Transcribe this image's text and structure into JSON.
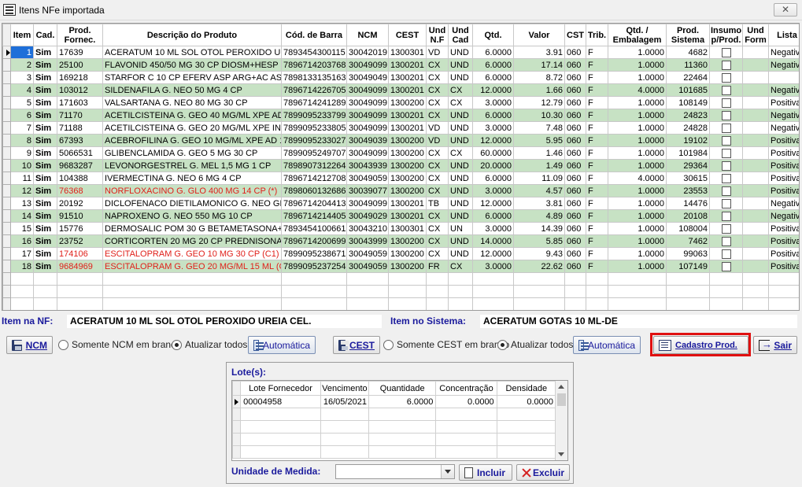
{
  "window": {
    "title": "Itens NFe importada",
    "close_label": "✕"
  },
  "grid": {
    "headers": {
      "item": "Item",
      "cad": "Cad.",
      "forn": "Prod.\nFornec.",
      "desc": "Descrição do Produto",
      "barra": "Cód. de Barra",
      "ncm": "NCM",
      "cest": "CEST",
      "undnf": "Und\nN.F",
      "undcad": "Und\nCad",
      "qtd": "Qtd.",
      "valor": "Valor",
      "cst": "CST",
      "trib": "Trib.",
      "qtdemb": "Qtd. /\nEmbalagem",
      "prodsis": "Prod.\nSistema",
      "insumo": "Insumo\np/Prod.",
      "undform": "Und\nForm",
      "lista": "Lista"
    },
    "rows": [
      {
        "item": "1",
        "cad": "Sim",
        "forn": "17639",
        "desc": "ACERATUM 10 ML SOL OTOL PEROXIDO UREIA CEL.",
        "barra": "7893454300115",
        "ncm": "30042019",
        "cest": "1300301",
        "undnf": "VD",
        "undcad": "UND",
        "qtd": "6.0000",
        "valor": "3.91",
        "cst": "060",
        "trib": "F",
        "qtdemb": "1.0000",
        "prodsis": "4682",
        "undform": "",
        "lista": "Negativa",
        "red": false
      },
      {
        "item": "2",
        "cad": "Sim",
        "forn": "25100",
        "desc": "FLAVONID 450/50 MG 30 CP DIOSM+HESP NEO",
        "barra": "7896714203768",
        "ncm": "30049099",
        "cest": "1300201",
        "undnf": "CX",
        "undcad": "UND",
        "qtd": "6.0000",
        "valor": "17.14",
        "cst": "060",
        "trib": "F",
        "qtdemb": "1.0000",
        "prodsis": "11360",
        "undform": "",
        "lista": "Negativa",
        "red": false
      },
      {
        "item": "3",
        "cad": "Sim",
        "forn": "169218",
        "desc": "STARFOR C 10 CP EFERV ASP ARG+AC ASC",
        "barra": "7898133135163",
        "ncm": "30049049",
        "cest": "1300201",
        "undnf": "CX",
        "undcad": "UND",
        "qtd": "6.0000",
        "valor": "8.72",
        "cst": "060",
        "trib": "F",
        "qtdemb": "1.0000",
        "prodsis": "22464",
        "undform": "",
        "lista": "",
        "red": false
      },
      {
        "item": "4",
        "cad": "Sim",
        "forn": "103012",
        "desc": "SILDENAFILA G. NEO 50 MG 4 CP",
        "barra": "7896714226705",
        "ncm": "30049099",
        "cest": "1300201",
        "undnf": "CX",
        "undcad": "CX",
        "qtd": "12.0000",
        "valor": "1.66",
        "cst": "060",
        "trib": "F",
        "qtdemb": "4.0000",
        "prodsis": "101685",
        "undform": "",
        "lista": "Negativa",
        "red": false
      },
      {
        "item": "5",
        "cad": "Sim",
        "forn": "171603",
        "desc": "VALSARTANA G. NEO 80 MG 30 CP",
        "barra": "7896714241289",
        "ncm": "30049099",
        "cest": "1300200",
        "undnf": "CX",
        "undcad": "CX",
        "qtd": "3.0000",
        "valor": "12.79",
        "cst": "060",
        "trib": "F",
        "qtdemb": "1.0000",
        "prodsis": "108149",
        "undform": "",
        "lista": "Positiva",
        "red": false
      },
      {
        "item": "6",
        "cad": "Sim",
        "forn": "71170",
        "desc": "ACETILCISTEINA G. GEO 40 MG/ML XPE AD 120 ML",
        "barra": "7899095233799",
        "ncm": "30049099",
        "cest": "1300201",
        "undnf": "CX",
        "undcad": "UND",
        "qtd": "6.0000",
        "valor": "10.30",
        "cst": "060",
        "trib": "F",
        "qtdemb": "1.0000",
        "prodsis": "24823",
        "undform": "",
        "lista": "Negativa",
        "red": false
      },
      {
        "item": "7",
        "cad": "Sim",
        "forn": "71188",
        "desc": "ACETILCISTEINA G. GEO 20 MG/ML XPE INF 120 ML",
        "barra": "7899095233805",
        "ncm": "30049099",
        "cest": "1300201",
        "undnf": "VD",
        "undcad": "UND",
        "qtd": "3.0000",
        "valor": "7.48",
        "cst": "060",
        "trib": "F",
        "qtdemb": "1.0000",
        "prodsis": "24828",
        "undform": "",
        "lista": "Negativa",
        "red": false
      },
      {
        "item": "8",
        "cad": "Sim",
        "forn": "67393",
        "desc": "ACEBROFILINA G. GEO 10 MG/ML XPE AD 120 ML",
        "barra": "7899095233027",
        "ncm": "30049039",
        "cest": "1300200",
        "undnf": "VD",
        "undcad": "UND",
        "qtd": "12.0000",
        "valor": "5.95",
        "cst": "060",
        "trib": "F",
        "qtdemb": "1.0000",
        "prodsis": "19102",
        "undform": "",
        "lista": "Positiva",
        "red": false
      },
      {
        "item": "9",
        "cad": "Sim",
        "forn": "5066531",
        "desc": "GLIBENCLAMIDA G. GEO 5 MG 30 CP",
        "barra": "7899095249707",
        "ncm": "30049099",
        "cest": "1300200",
        "undnf": "CX",
        "undcad": "CX",
        "qtd": "60.0000",
        "valor": "1.46",
        "cst": "060",
        "trib": "F",
        "qtdemb": "1.0000",
        "prodsis": "101984",
        "undform": "",
        "lista": "Positiva",
        "red": false
      },
      {
        "item": "10",
        "cad": "Sim",
        "forn": "9683287",
        "desc": "LEVONORGESTREL G. MEL 1,5 MG 1 CP",
        "barra": "7898907312264",
        "ncm": "30043939",
        "cest": "1300200",
        "undnf": "CX",
        "undcad": "UND",
        "qtd": "20.0000",
        "valor": "1.49",
        "cst": "060",
        "trib": "F",
        "qtdemb": "1.0000",
        "prodsis": "29364",
        "undform": "",
        "lista": "Positiva",
        "red": false
      },
      {
        "item": "11",
        "cad": "Sim",
        "forn": "104388",
        "desc": "IVERMECTINA G. NEO 6 MG 4 CP",
        "barra": "7896714212708",
        "ncm": "30049059",
        "cest": "1300200",
        "undnf": "CX",
        "undcad": "UND",
        "qtd": "6.0000",
        "valor": "11.09",
        "cst": "060",
        "trib": "F",
        "qtdemb": "4.0000",
        "prodsis": "30615",
        "undform": "",
        "lista": "Positiva",
        "red": false
      },
      {
        "item": "12",
        "cad": "Sim",
        "forn": "76368",
        "desc": "NORFLOXACINO G. GLO 400 MG 14 CP (*)",
        "barra": "7898060132686",
        "ncm": "30039077",
        "cest": "1300200",
        "undnf": "CX",
        "undcad": "UND",
        "qtd": "3.0000",
        "valor": "4.57",
        "cst": "060",
        "trib": "F",
        "qtdemb": "1.0000",
        "prodsis": "23553",
        "undform": "",
        "lista": "Positiva",
        "red": true
      },
      {
        "item": "13",
        "cad": "Sim",
        "forn": "20192",
        "desc": "DICLOFENACO DIETILAMONICO G. NEO GEL 1% 60 G",
        "barra": "7896714204413",
        "ncm": "30049099",
        "cest": "1300201",
        "undnf": "TB",
        "undcad": "UND",
        "qtd": "12.0000",
        "valor": "3.81",
        "cst": "060",
        "trib": "F",
        "qtdemb": "1.0000",
        "prodsis": "14476",
        "undform": "",
        "lista": "Negativa",
        "red": false
      },
      {
        "item": "14",
        "cad": "Sim",
        "forn": "91510",
        "desc": "NAPROXENO G. NEO 550 MG 10 CP",
        "barra": "7896714214405",
        "ncm": "30049029",
        "cest": "1300201",
        "undnf": "CX",
        "undcad": "UND",
        "qtd": "6.0000",
        "valor": "4.89",
        "cst": "060",
        "trib": "F",
        "qtdemb": "1.0000",
        "prodsis": "20108",
        "undform": "",
        "lista": "Negativa",
        "red": false
      },
      {
        "item": "15",
        "cad": "Sim",
        "forn": "15776",
        "desc": "DERMOSALIC POM 30 G BETAMETASONA+AC SALIC",
        "barra": "7893454100661",
        "ncm": "30043210",
        "cest": "1300301",
        "undnf": "CX",
        "undcad": "UN",
        "qtd": "3.0000",
        "valor": "14.39",
        "cst": "060",
        "trib": "F",
        "qtdemb": "1.0000",
        "prodsis": "108004",
        "undform": "",
        "lista": "Positiva",
        "red": false
      },
      {
        "item": "16",
        "cad": "Sim",
        "forn": "23752",
        "desc": "CORTICORTEN 20 MG 20 CP PREDNISONA NEO",
        "barra": "7896714200699",
        "ncm": "30043999",
        "cest": "1300200",
        "undnf": "CX",
        "undcad": "UND",
        "qtd": "14.0000",
        "valor": "5.85",
        "cst": "060",
        "trib": "F",
        "qtdemb": "1.0000",
        "prodsis": "7462",
        "undform": "",
        "lista": "Positiva",
        "red": false
      },
      {
        "item": "17",
        "cad": "Sim",
        "forn": "174106",
        "desc": "ESCITALOPRAM G. GEO 10 MG 30 CP (C1)",
        "barra": "7899095238671",
        "ncm": "30049059",
        "cest": "1300200",
        "undnf": "CX",
        "undcad": "UND",
        "qtd": "12.0000",
        "valor": "9.43",
        "cst": "060",
        "trib": "F",
        "qtdemb": "1.0000",
        "prodsis": "99063",
        "undform": "",
        "lista": "Positiva",
        "red": true
      },
      {
        "item": "18",
        "cad": "Sim",
        "forn": "9684969",
        "desc": "ESCITALOPRAM G. GEO 20 MG/ML 15 ML (C1)",
        "barra": "7899095237254",
        "ncm": "30049059",
        "cest": "1300200",
        "undnf": "FR",
        "undcad": "CX",
        "qtd": "3.0000",
        "valor": "22.62",
        "cst": "060",
        "trib": "F",
        "qtdemb": "1.0000",
        "prodsis": "107149",
        "undform": "",
        "lista": "Positiva",
        "red": true
      }
    ]
  },
  "item_nf": {
    "label": "Item na NF:",
    "value": "ACERATUM 10 ML SOL OTOL PEROXIDO UREIA CEL."
  },
  "item_sistema": {
    "label": "Item no Sistema:",
    "value": "ACERATUM GOTAS 10 ML-DE"
  },
  "ncm_bar": {
    "button": "NCM",
    "radio_blank": "Somente NCM em branco",
    "radio_all": "Atualizar todos",
    "auto": "Automática"
  },
  "cest_bar": {
    "button": "CEST",
    "radio_blank": "Somente CEST em branco",
    "radio_all": "Atualizar todos",
    "auto": "Automática"
  },
  "cadastro_button": "Cadastro Prod.",
  "sair_button": "Sair",
  "lote": {
    "title": "Lote(s):",
    "headers": [
      "Lote Fornecedor",
      "Vencimento",
      "Quantidade",
      "Concentração",
      "Densidade"
    ],
    "rows": [
      {
        "lote": "00004958",
        "venc": "16/05/2021",
        "qtd": "6.0000",
        "conc": "0.0000",
        "dens": "0.0000"
      }
    ],
    "unidade_label": "Unidade de Medida:",
    "unidade_value": "",
    "incluir": "Incluir",
    "excluir": "Excluir"
  },
  "colors": {
    "row_alt": "#c7e2c4",
    "label_blue": "#1a1a9c",
    "highlight": "#e01010",
    "red_text": "#e0201a"
  }
}
